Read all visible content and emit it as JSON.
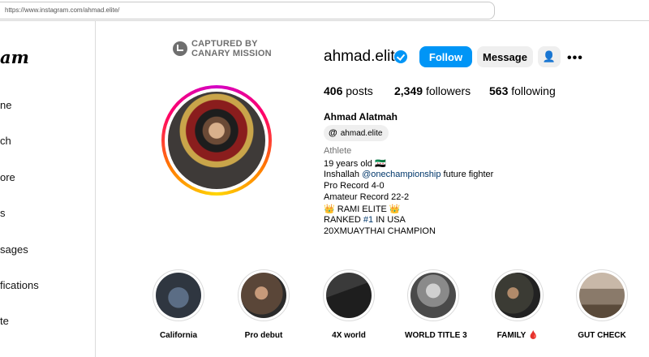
{
  "browser": {
    "url": "https://www.instagram.com/ahmad.elite/"
  },
  "sidebar": {
    "logo": "am",
    "items": [
      {
        "label": "ne"
      },
      {
        "label": "ch"
      },
      {
        "label": "ore"
      },
      {
        "label": "s"
      },
      {
        "label": "sages"
      },
      {
        "label": "fications"
      },
      {
        "label": "te"
      }
    ]
  },
  "watermark": {
    "line1": "CAPTURED BY",
    "line2": "CANARY MISSION"
  },
  "profile": {
    "username": "ahmad.elite",
    "verified": true,
    "follow_label": "Follow",
    "message_label": "Message",
    "adduser_icon": "👤",
    "more_label": "•••",
    "stats": {
      "posts_count": "406",
      "posts_label": "posts",
      "followers_count": "2,349",
      "followers_label": "followers",
      "following_count": "563",
      "following_label": "following"
    },
    "full_name": "Ahmad Alatmah",
    "threads_handle": "ahmad.elite",
    "threads_icon": "@",
    "category": "Athlete",
    "bio": {
      "line1": "19 years old 🇸🇾",
      "line2_pre": "Inshallah ",
      "line2_link": "@onechampionship",
      "line2_post": " future fighter",
      "line3": "Pro Record 4-0",
      "line4": "Amateur Record 22-2",
      "line5": "👑 RAMI ELITE 👑",
      "line6_pre": "RANKED ",
      "line6_link": "#1",
      "line6_post": " IN USA",
      "line7": "20XMUAYTHAI CHAMPION"
    }
  },
  "highlights": [
    {
      "label": "California",
      "color": "#2f3640"
    },
    {
      "label": "Pro debut",
      "color": "#5a4638"
    },
    {
      "label": "4X world",
      "color": "#1e1e1e"
    },
    {
      "label": "WORLD TITLE 3",
      "color": "#6e6e6e"
    },
    {
      "label": "FAMILY 🩸",
      "color": "#3b3b34"
    },
    {
      "label": "GUT CHECK",
      "color": "#8a7a6a"
    }
  ],
  "colors": {
    "accent": "#0095f6",
    "link": "#00376b"
  }
}
